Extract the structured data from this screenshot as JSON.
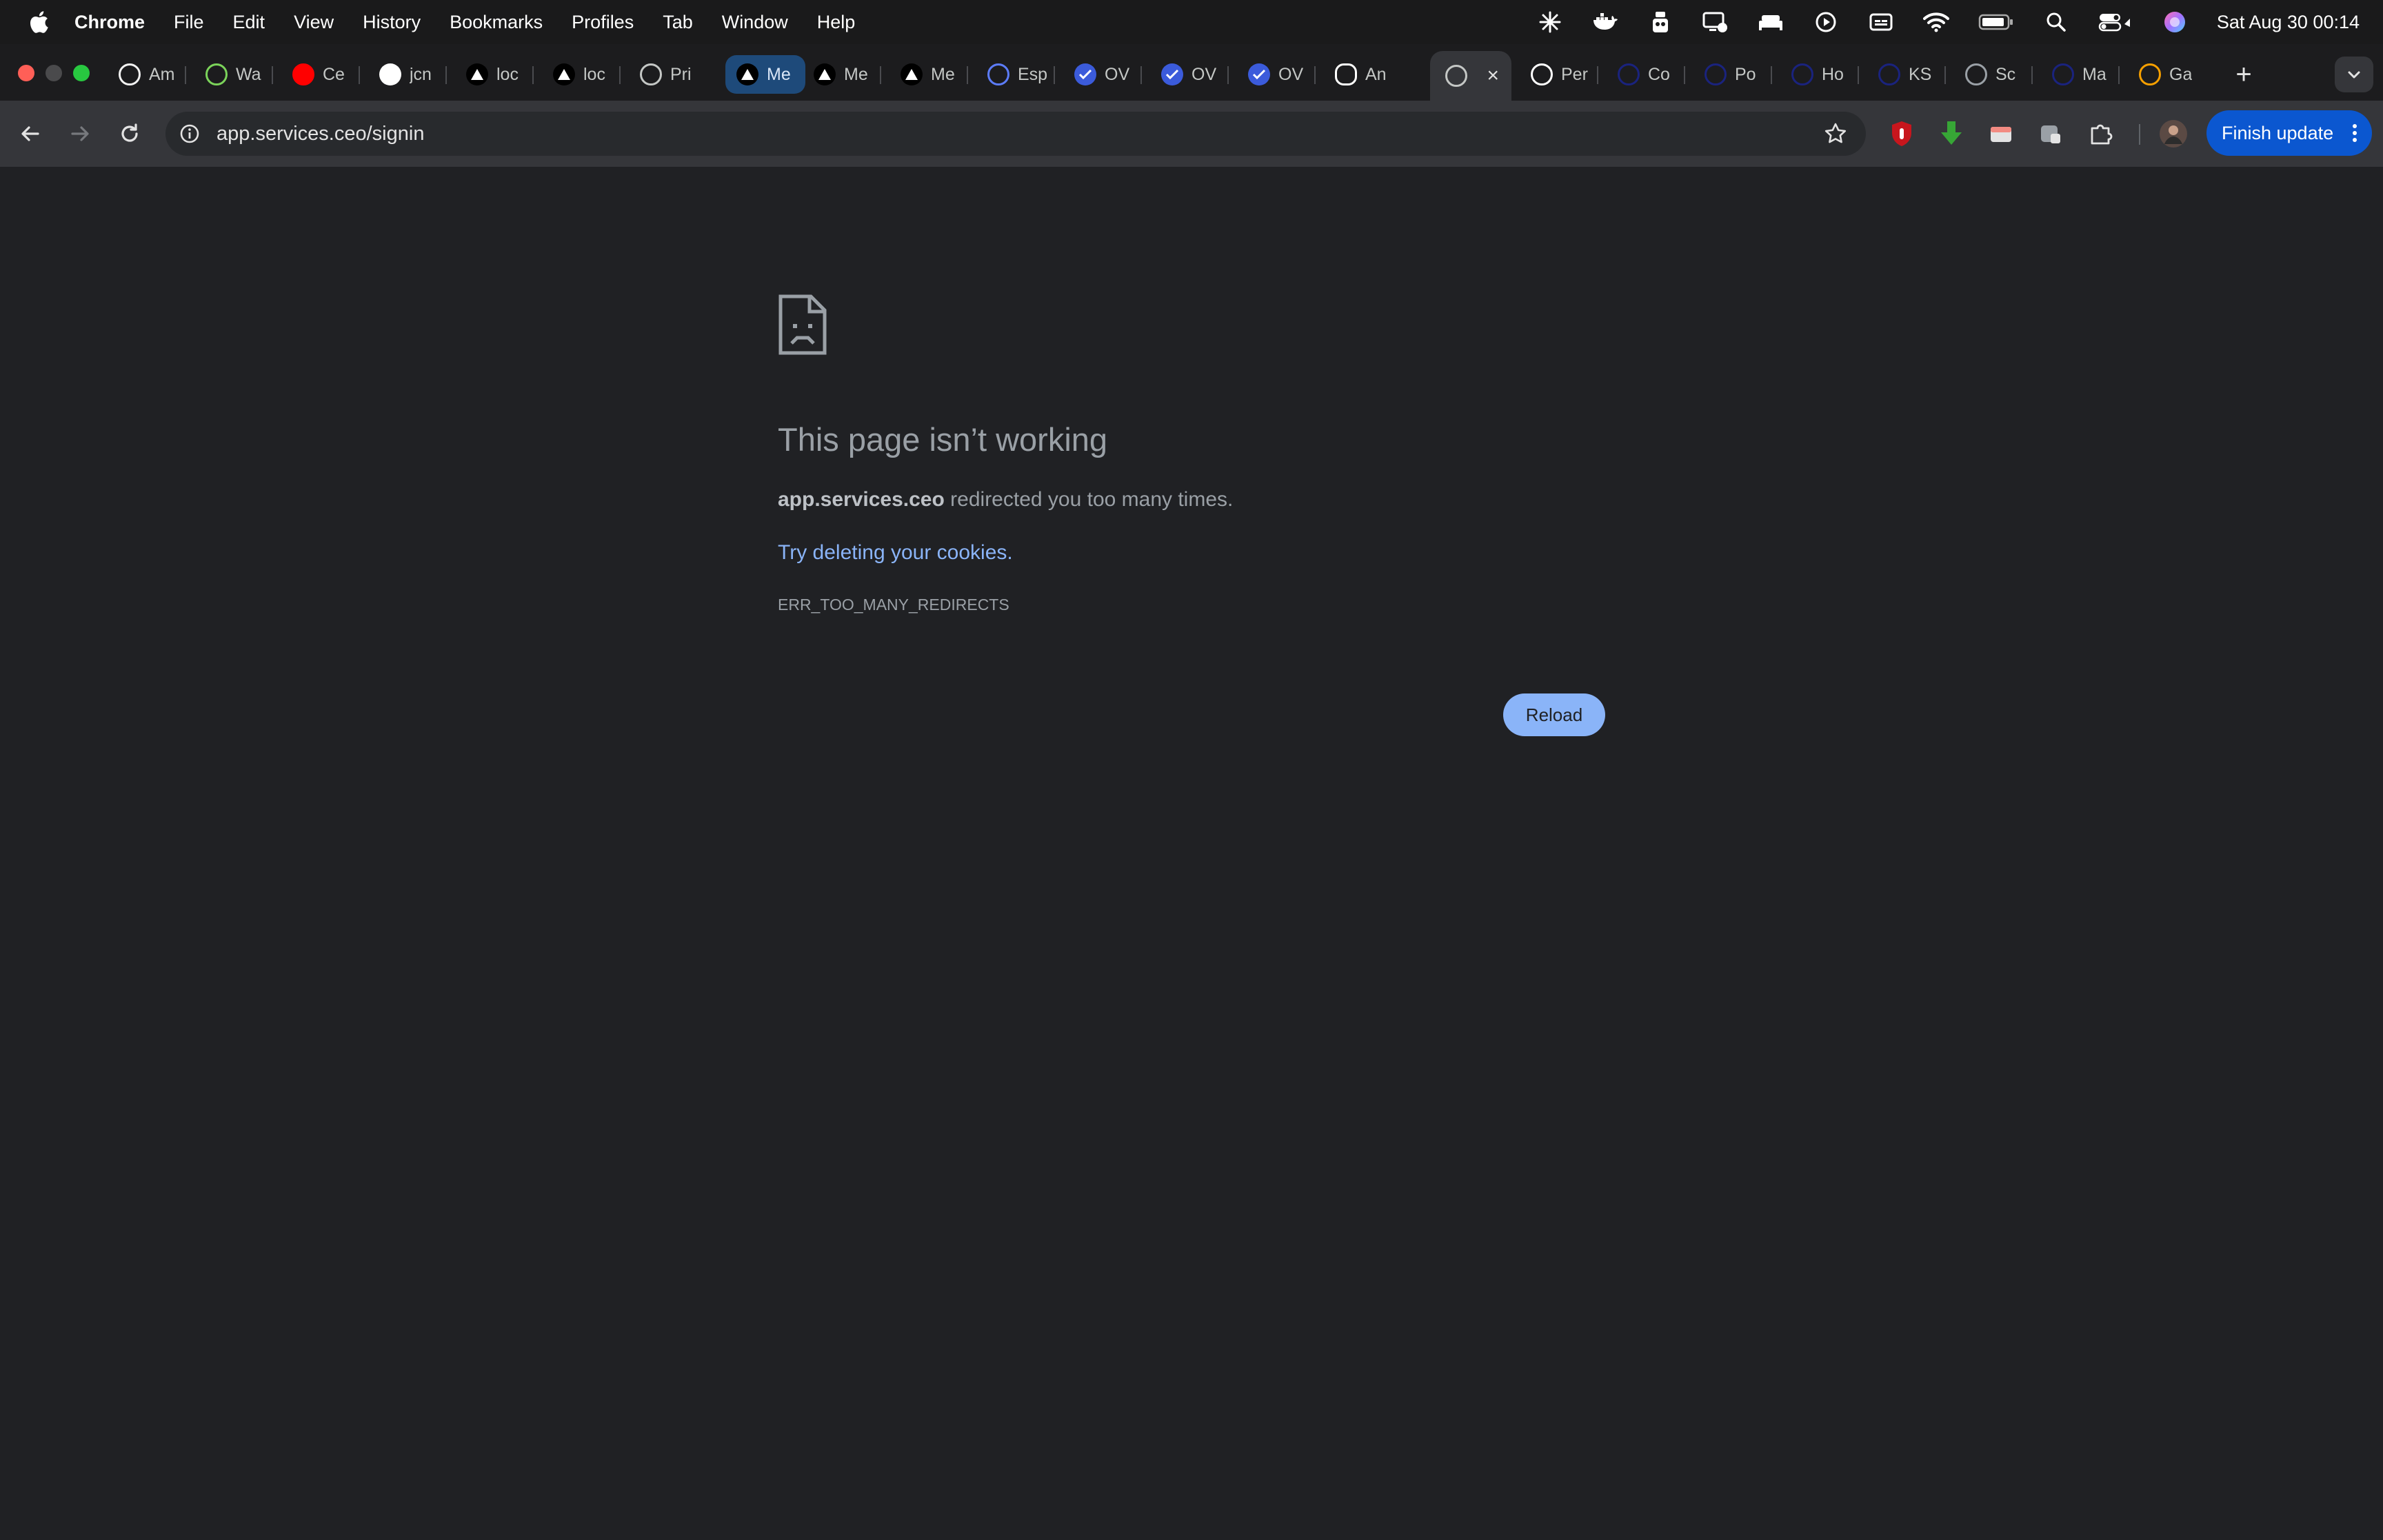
{
  "menubar": {
    "app_name": "Chrome",
    "items": [
      "File",
      "Edit",
      "View",
      "History",
      "Bookmarks",
      "Profiles",
      "Tab",
      "Window",
      "Help"
    ],
    "clock": "Sat Aug 30  00:14",
    "status_icons": [
      "sparkle-icon",
      "docker-icon",
      "tool-icon",
      "screen-share-icon",
      "bed-icon",
      "play-icon",
      "caption-icon",
      "wifi-icon",
      "battery-icon",
      "search-icon",
      "control-center-icon",
      "siri-icon"
    ]
  },
  "tabs": [
    {
      "label": "Am",
      "icon": "amazon-icon",
      "color": "#f2f2f2"
    },
    {
      "label": "Wa",
      "icon": "frog-icon",
      "color": "#7bd35a"
    },
    {
      "label": "Ce",
      "icon": "youtube-icon",
      "color": "#ff0000"
    },
    {
      "label": "jcn",
      "icon": "github-icon",
      "color": "#ffffff"
    },
    {
      "label": "loc",
      "icon": "triangle-icon",
      "color": "#ffffff"
    },
    {
      "label": "loc",
      "icon": "triangle-icon",
      "color": "#ffffff"
    },
    {
      "label": "Pri",
      "icon": "globe-icon",
      "color": "#c4c7c5"
    },
    {
      "label": "Me",
      "icon": "triangle-icon",
      "color": "#ffffff"
    },
    {
      "label": "Me",
      "icon": "triangle-icon",
      "color": "#ffffff"
    },
    {
      "label": "Me",
      "icon": "triangle-icon",
      "color": "#ffffff"
    },
    {
      "label": "Esp",
      "icon": "globe-icon",
      "color": "#5c7cfa"
    },
    {
      "label": "OV",
      "icon": "check-icon",
      "color": "#3b5bdb"
    },
    {
      "label": "OV",
      "icon": "check-icon",
      "color": "#3b5bdb"
    },
    {
      "label": "OV",
      "icon": "check-icon",
      "color": "#3b5bdb"
    },
    {
      "label": "An",
      "icon": "eye-icon",
      "color": "#ffffff"
    },
    {
      "label": "",
      "icon": "globe-icon",
      "color": "#c4c7c5"
    },
    {
      "label": "Per",
      "icon": "m-icon",
      "color": "#ffffff"
    },
    {
      "label": "Co",
      "icon": "circle-icon",
      "color": "#1a237e"
    },
    {
      "label": "Po",
      "icon": "circle-icon",
      "color": "#1a237e"
    },
    {
      "label": "Ho",
      "icon": "w-icon",
      "color": "#1a237e"
    },
    {
      "label": "KS",
      "icon": "circle-icon",
      "color": "#1a237e"
    },
    {
      "label": "Sc",
      "icon": "gear-icon",
      "color": "#9aa0a6"
    },
    {
      "label": "Ma",
      "icon": "circle-icon",
      "color": "#1a237e"
    },
    {
      "label": "Ga",
      "icon": "globe-icon",
      "color": "#f59f00"
    }
  ],
  "toolbar": {
    "url": "app.services.ceo/signin",
    "finish_update": "Finish update"
  },
  "error": {
    "title": "This page isn’t working",
    "host": "app.services.ceo",
    "message": " redirected you too many times.",
    "link": "Try deleting your cookies.",
    "code": "ERR_TOO_MANY_REDIRECTS",
    "reload": "Reload"
  },
  "colors": {
    "background": "#202124",
    "link": "#8ab4f8",
    "button": "#8ab4f8",
    "update_button": "#0b57d0"
  }
}
